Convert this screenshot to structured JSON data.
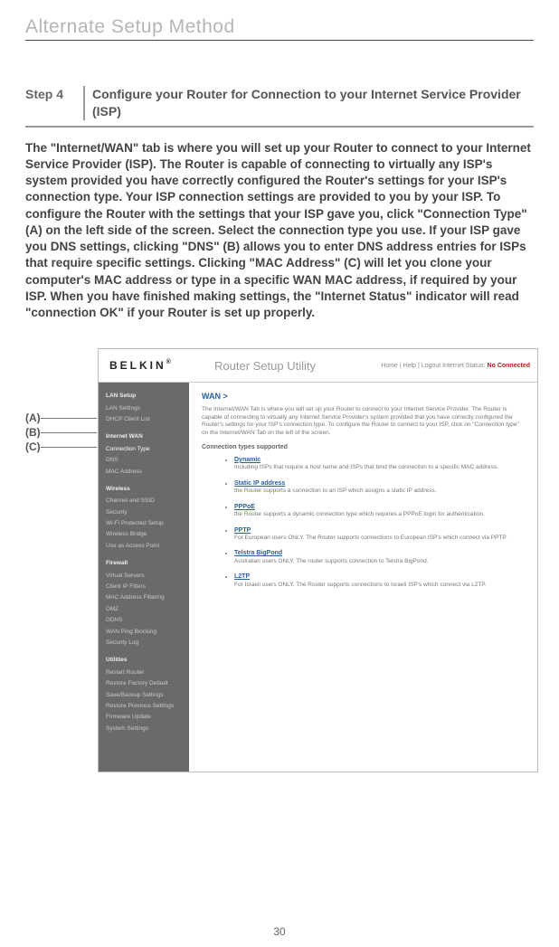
{
  "section_title": "Alternate Setup Method",
  "step_label": "Step 4",
  "step_heading": "Configure your Router for Connection to your Internet Service Provider (ISP)",
  "body_text": "The \"Internet/WAN\" tab is where you will set up your Router to connect to your Internet Service Provider (ISP). The Router is capable of connecting to virtually any ISP's system provided you have correctly configured the Router's settings for your ISP's connection type. Your ISP connection settings are provided to you by your ISP. To configure the Router with the settings that your ISP gave you, click \"Connection Type\" (A) on the left side of the screen. Select the connection type you use. If your ISP gave you DNS settings, clicking \"DNS\" (B) allows you to enter DNS address entries for ISPs that require specific settings. Clicking \"MAC Address\" (C) will let you clone your computer's MAC address or type in a specific WAN MAC address, if required by your ISP. When you have finished making settings, the \"Internet Status\" indicator will read \"connection OK\" if your Router is set up properly.",
  "callouts": {
    "a": "(A)",
    "b": "(B)",
    "c": "(C)"
  },
  "shot": {
    "logo": "BELKIN",
    "app_title": "Router Setup Utility",
    "header_links": "Home | Help | Logout   Internet Status:",
    "header_status": "No Connected",
    "sidebar": {
      "lan_setup": "LAN Setup",
      "lan_items": [
        "LAN Settings",
        "DHCP Client List"
      ],
      "wan": "Internet WAN",
      "wan_items": [
        "Connection Type",
        "DNS",
        "MAC Address"
      ],
      "wireless": "Wireless",
      "wireless_items": [
        "Channel and SSID",
        "Security",
        "Wi-Fi Protected Setup",
        "Wireless Bridge",
        "Use as Access Point"
      ],
      "firewall": "Firewall",
      "firewall_items": [
        "Virtual Servers",
        "Client IP Filters",
        "MAC Address Filtering",
        "DMZ",
        "DDNS",
        "WAN Ping Blocking",
        "Security Log"
      ],
      "utilities": "Utilities",
      "utilities_items": [
        "Restart Router",
        "Restore Factory Default",
        "Save/Backup Settings",
        "Restore Previous Settings",
        "Firmware Update",
        "System Settings"
      ]
    },
    "content": {
      "heading": "WAN >",
      "intro": "The Internet/WAN Tab is where you will set up your Router to connect to your Internet Service Provider. The Router is capable of connecting to virtually any Internet Service Provider's system provided that you have correctly configured the Router's settings for your ISP's connection type. To configure the Router to connect to your ISP, click on \"Connection type\" on the Internet/WAN Tab on the left of the screen.",
      "subhead": "Connection types supported",
      "types": [
        {
          "name": "Dynamic",
          "desc": "Including ISPs that require a host name and ISPs that bind the connection to a specific MAC address."
        },
        {
          "name": "Static IP address",
          "desc": "the Router supports a connection to an ISP which assigns a static IP address."
        },
        {
          "name": "PPPoE",
          "desc": "the Router supports a dynamic connection type which requires a PPPoE login for authentication."
        },
        {
          "name": "PPTP",
          "desc": "For European users ONLY. The Router supports connections to European ISP's which connect via PPTP."
        },
        {
          "name": "Telstra BigPond",
          "desc": "Australian users ONLY. The router supports connection to Telstra BigPond."
        },
        {
          "name": "L2TP",
          "desc": "For Israeli users ONLY. The Router supports connections to Israeli ISP's which connect via L2TP."
        }
      ]
    }
  },
  "page_number": "30"
}
